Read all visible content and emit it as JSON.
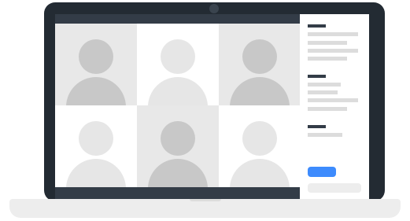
{
  "video_call": {
    "participants": [
      {
        "tone": "dark"
      },
      {
        "tone": "light"
      },
      {
        "tone": "dark"
      },
      {
        "tone": "light"
      },
      {
        "tone": "dark"
      },
      {
        "tone": "light"
      }
    ]
  },
  "sidebar": {
    "join_button_label": "",
    "input_placeholder": ""
  },
  "colors": {
    "accent": "#3d8bfd",
    "frame": "#232b33",
    "bars": "#333c47"
  }
}
